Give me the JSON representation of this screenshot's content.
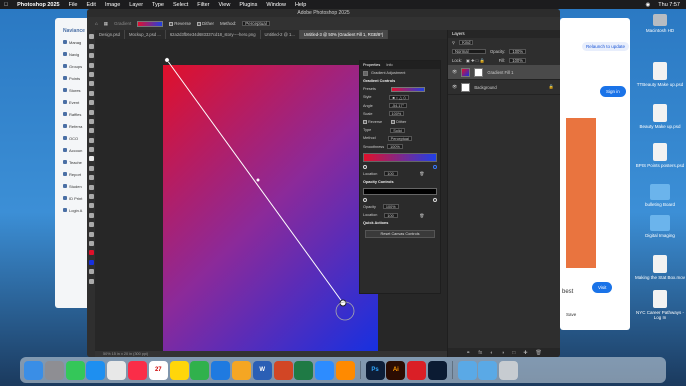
{
  "menubar": {
    "app": "Photoshop 2025",
    "items": [
      "File",
      "Edit",
      "Image",
      "Layer",
      "Type",
      "Select",
      "Filter",
      "View",
      "Plugins",
      "Window",
      "Help"
    ],
    "clock": "Thu 7:57"
  },
  "browser_left": {
    "items": [
      "Manag",
      "Navig",
      "Groups",
      "Points",
      "Stores",
      "Event",
      "Raffles",
      "Referra",
      "OCO",
      "Accoun",
      "Teache",
      "Report",
      "Studen",
      "ID Print",
      "Login A"
    ],
    "logo": "Naviance"
  },
  "browser_right": {
    "relaunch_label": "Relaunch to update",
    "signin_label": "Sign in",
    "visit_label": "Visit",
    "save_label": "Save",
    "best_text": "best"
  },
  "desktop_icons": [
    {
      "label": "Macintosh HD",
      "kind": "drive"
    },
    {
      "label": "TTBeauty Make up.psd",
      "kind": "doc"
    },
    {
      "label": "Beauty Make up.psd",
      "kind": "doc"
    },
    {
      "label": "BPIS Points posters.psd",
      "kind": "doc"
    },
    {
      "label": "bulleting Board",
      "kind": "folder"
    },
    {
      "label": "Digital Imaging",
      "kind": "folder"
    },
    {
      "label": "Making the Stat Box.mov",
      "kind": "doc"
    },
    {
      "label": "NYC Career Pathways - Log In",
      "kind": "doc"
    }
  ],
  "photoshop": {
    "title": "Adobe Photoshop 2025",
    "options": {
      "reverse": "Reverse",
      "dither": "Dither",
      "method_label": "Method:",
      "method_value": "Perceptual",
      "gradient_label": "Gradient"
    },
    "tabs": [
      {
        "label": "Design.psd",
        "active": false
      },
      {
        "label": "Mockup_2.psd ...",
        "active": false
      },
      {
        "label": "62a2d3fb6e34d683337cd18_story----hero.png",
        "active": false
      },
      {
        "label": "Untitled-2 @ 1...",
        "active": false
      },
      {
        "label": "Untitled-3 @ 50% (Gradient Fill 1, RGB/8*)",
        "active": true
      }
    ],
    "status": "50%   15 in x 20 in (300 ppi)",
    "properties": {
      "tab_properties": "Properties",
      "tab_info": "Info",
      "adjustment": "Gradient Adjustment",
      "section": "Gradient Controls",
      "presets_label": "Presets",
      "style_label": "Style",
      "angle_label": "Angle",
      "angle_value": "-54.17°",
      "scale_label": "Scale",
      "scale_value": "100%",
      "reverse_label": "Reverse",
      "dither_label": "Dither",
      "type_label": "Type",
      "type_value": "Solid",
      "method_label": "Method",
      "method_value": "Perceptual",
      "smoothness_label": "Smoothness",
      "smoothness_value": "100%",
      "location_label": "Location",
      "location_value": "100",
      "opacity_section": "Opacity Controls",
      "opacity_label": "Opacity",
      "opacity_value": "100%",
      "opacity_location_label": "Location",
      "opacity_location_value": "100",
      "quick_actions": "Quick Actions",
      "reset_button": "Reset Canvas Controls"
    },
    "layers": {
      "title": "Layers",
      "kind_label": "Kind",
      "blend_mode": "Normal",
      "opacity_label": "Opacity:",
      "opacity_value": "100%",
      "lock_label": "Lock:",
      "fill_label": "Fill:",
      "fill_value": "100%",
      "items": [
        {
          "name": "Gradient Fill 1",
          "selected": true
        },
        {
          "name": "Background",
          "selected": false
        }
      ]
    }
  },
  "dock": {
    "apps": [
      {
        "name": "Finder",
        "color": "#3a8ee6"
      },
      {
        "name": "Launchpad",
        "color": "#8e8e93"
      },
      {
        "name": "Messages",
        "color": "#34c759"
      },
      {
        "name": "Safari",
        "color": "#1e8ff0"
      },
      {
        "name": "Chrome",
        "color": "#e8e8e8"
      },
      {
        "name": "Music",
        "color": "#fa2d48"
      },
      {
        "name": "Calendar",
        "color": "#ffffff"
      },
      {
        "name": "Notes",
        "color": "#ffd60a"
      },
      {
        "name": "Numbers",
        "color": "#30b14c"
      },
      {
        "name": "Keynote",
        "color": "#1f7ae0"
      },
      {
        "name": "Photos",
        "color": "#f5a623"
      },
      {
        "name": "Word",
        "color": "#2b5fb5"
      },
      {
        "name": "PowerPoint",
        "color": "#d24625"
      },
      {
        "name": "Excel",
        "color": "#1f7a45"
      },
      {
        "name": "Zoom",
        "color": "#2d8cff"
      },
      {
        "name": "Books",
        "color": "#ff8a00"
      },
      {
        "name": "Photoshop",
        "color": "#0d1e38"
      },
      {
        "name": "Illustrator",
        "color": "#2b0c02"
      },
      {
        "name": "Creative Cloud",
        "color": "#da1f26"
      },
      {
        "name": "Lightroom",
        "color": "#0b1b33"
      },
      {
        "name": "Folder",
        "color": "#5aa9e6"
      },
      {
        "name": "Downloads",
        "color": "#5aa9e6"
      },
      {
        "name": "Trash",
        "color": "#c7ccd1"
      }
    ],
    "glyphs": {
      "Photoshop": "Ps",
      "Illustrator": "Ai",
      "Word": "W",
      "Calendar": "27"
    }
  }
}
